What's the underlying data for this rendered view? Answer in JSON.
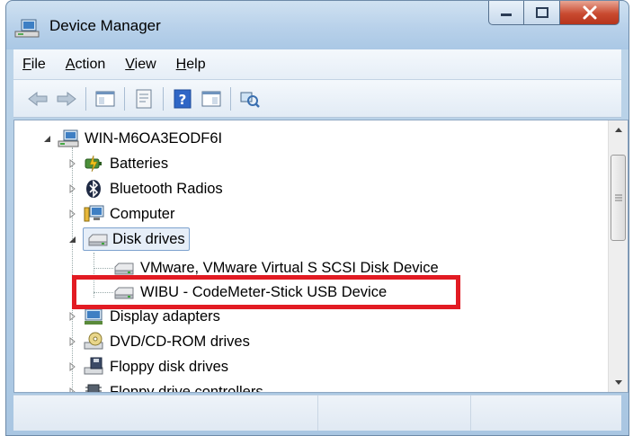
{
  "window": {
    "title": "Device Manager"
  },
  "menu": [
    {
      "key": "F",
      "rest": "ile"
    },
    {
      "key": "A",
      "rest": "ction"
    },
    {
      "key": "V",
      "rest": "iew"
    },
    {
      "key": "H",
      "rest": "elp"
    }
  ],
  "tree": {
    "root": "WIN-M6OA3EODF6I",
    "items": [
      {
        "label": "Batteries",
        "icon": "battery-icon",
        "state": "collapsed"
      },
      {
        "label": "Bluetooth Radios",
        "icon": "bluetooth-icon",
        "state": "collapsed"
      },
      {
        "label": "Computer",
        "icon": "computer-icon",
        "state": "collapsed"
      },
      {
        "label": "Disk drives",
        "icon": "disk-drive-icon",
        "state": "expanded",
        "children": [
          "VMware, VMware Virtual S SCSI Disk Device",
          "WIBU - CodeMeter-Stick USB Device"
        ]
      },
      {
        "label": "Display adapters",
        "icon": "display-adapter-icon",
        "state": "collapsed"
      },
      {
        "label": "DVD/CD-ROM drives",
        "icon": "dvd-drive-icon",
        "state": "collapsed"
      },
      {
        "label": "Floppy disk drives",
        "icon": "floppy-drive-icon",
        "state": "collapsed"
      },
      {
        "label": "Floppy drive controllers",
        "icon": "floppy-controller-icon",
        "state": "collapsed"
      }
    ]
  },
  "colors": {
    "highlight": "#e21b23",
    "selection": "#e6eef8"
  }
}
